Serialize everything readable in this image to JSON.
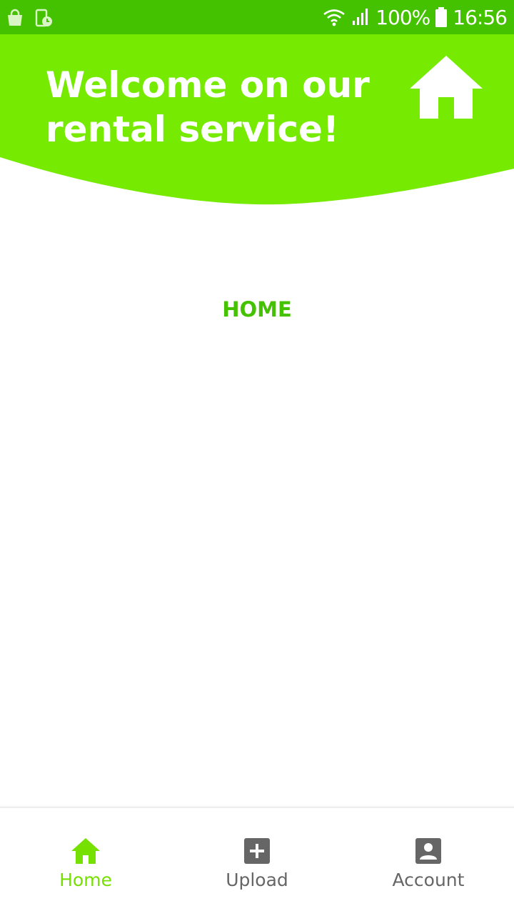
{
  "status_bar": {
    "battery": "100%",
    "time": "16:56",
    "icons": [
      "shopping-bag-icon",
      "screen-timer-icon",
      "wifi-icon",
      "signal-icon",
      "battery-icon"
    ]
  },
  "header": {
    "title": "Welcome on our rental service!",
    "icon": "home-icon"
  },
  "main": {
    "label": "HOME"
  },
  "bottom_nav": {
    "items": [
      {
        "label": "Home",
        "icon": "home-icon",
        "active": true
      },
      {
        "label": "Upload",
        "icon": "add-box-icon",
        "active": false
      },
      {
        "label": "Account",
        "icon": "account-box-icon",
        "active": false
      }
    ]
  },
  "colors": {
    "status_bar": "#44c200",
    "header": "#76ea00",
    "accent_text": "#44c200",
    "nav_active": "#76e000",
    "nav_inactive": "#666666"
  }
}
